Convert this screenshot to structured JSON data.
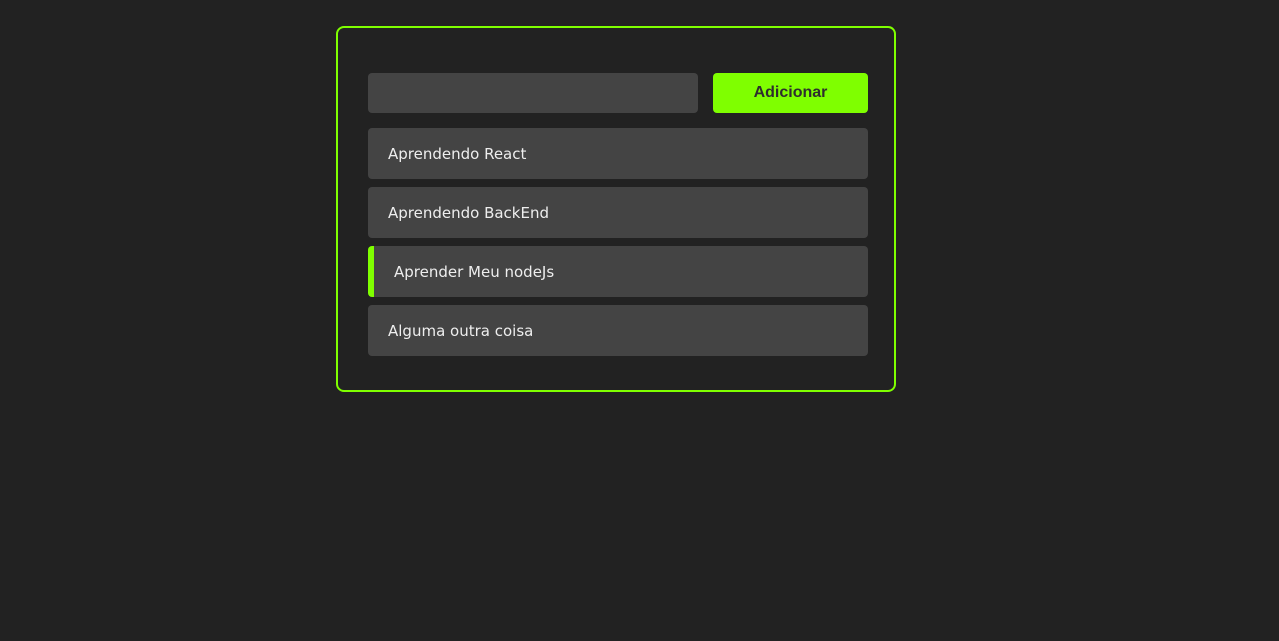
{
  "form": {
    "input_value": "",
    "input_placeholder": "",
    "add_button_label": "Adicionar"
  },
  "tasks": [
    {
      "title": "Aprendendo React",
      "completed": false
    },
    {
      "title": "Aprendendo BackEnd",
      "completed": false
    },
    {
      "title": "Aprender Meu nodeJs",
      "completed": true
    },
    {
      "title": "Alguma outra coisa",
      "completed": false
    }
  ],
  "colors": {
    "background": "#222222",
    "accent": "#7fff00",
    "item_background": "#444444",
    "text": "#eeeeee"
  }
}
